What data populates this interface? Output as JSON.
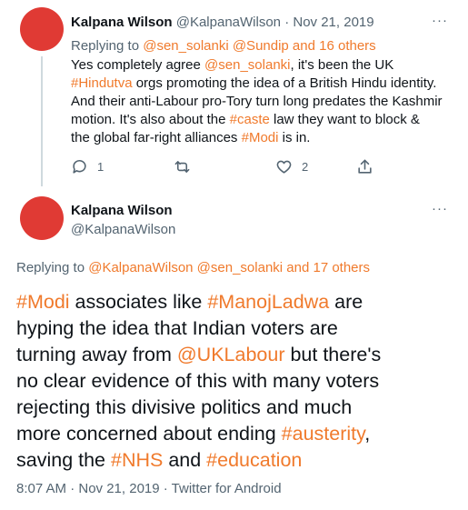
{
  "colors": {
    "accent": "#f07a2c",
    "avatar": "#e03a34",
    "muted": "#536471",
    "text": "#0f1419"
  },
  "tweet1": {
    "display_name": "Kalpana Wilson",
    "handle": "@KalpanaWilson",
    "separator": "·",
    "date": "Nov 21, 2019",
    "more_icon": "more-icon",
    "more_label": "···",
    "replying_prefix": "Replying to",
    "replying_users": "@sen_solanki @Sundip and 16 others",
    "body_lines": [
      [
        {
          "t": "Yes completely agree "
        },
        {
          "t": "@sen_solanki",
          "a": true
        },
        {
          "t": ", it's been the UK"
        }
      ],
      [
        {
          "t": "#Hindutva",
          "a": true
        },
        {
          "t": " orgs promoting the idea of a British Hindu identity."
        }
      ],
      [
        {
          "t": "And their anti-Labour pro-Tory turn long predates the Kashmir"
        }
      ],
      [
        {
          "t": "motion. It's also about the "
        },
        {
          "t": "#caste",
          "a": true
        },
        {
          "t": " law they want to block &"
        }
      ],
      [
        {
          "t": "the global far-right alliances "
        },
        {
          "t": "#Modi",
          "a": true
        },
        {
          "t": " is in."
        }
      ]
    ],
    "actions": {
      "reply_count": "1",
      "retweet_count": "",
      "like_count": "2",
      "share_count": ""
    }
  },
  "tweet2": {
    "display_name": "Kalpana Wilson",
    "handle": "@KalpanaWilson",
    "more_label": "···",
    "replying_prefix": "Replying to",
    "replying_users": "@KalpanaWilson @sen_solanki and 17 others",
    "body_lines": [
      [
        {
          "t": "#Modi",
          "a": true
        },
        {
          "t": " associates like "
        },
        {
          "t": "#ManojLadwa",
          "a": true
        },
        {
          "t": " are"
        }
      ],
      [
        {
          "t": "hyping the idea that Indian voters are"
        }
      ],
      [
        {
          "t": "turning away from "
        },
        {
          "t": "@UKLabour",
          "a": true
        },
        {
          "t": " but there's"
        }
      ],
      [
        {
          "t": "no clear evidence of this with many voters"
        }
      ],
      [
        {
          "t": "rejecting this divisive politics and  much"
        }
      ],
      [
        {
          "t": "more concerned about ending "
        },
        {
          "t": "#austerity",
          "a": true
        },
        {
          "t": ","
        }
      ],
      [
        {
          "t": "saving the "
        },
        {
          "t": "#NHS",
          "a": true
        },
        {
          "t": " and "
        },
        {
          "t": "#education",
          "a": true
        }
      ]
    ],
    "meta": "8:07 AM · Nov 21, 2019 · Twitter for Android"
  }
}
